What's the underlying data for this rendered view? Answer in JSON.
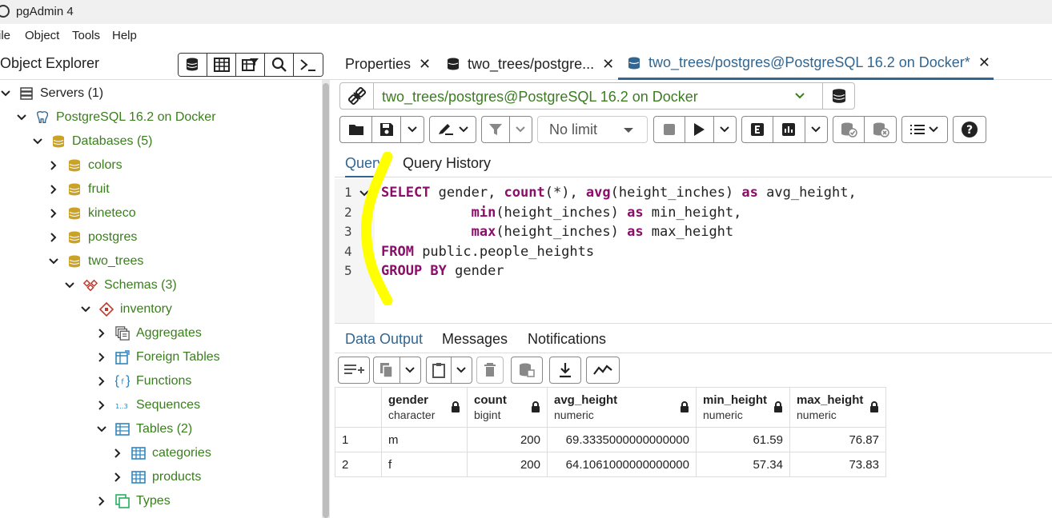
{
  "app": {
    "title": "pgAdmin 4"
  },
  "menu": [
    "ile",
    "Object",
    "Tools",
    "Help"
  ],
  "object_explorer": {
    "title": "Object Explorer",
    "toolbar_icons": [
      "database-query-icon",
      "table-icon",
      "filtered-rows-icon",
      "search-icon",
      "terminal-icon"
    ],
    "tree": [
      {
        "label": "Servers (1)",
        "level": 0,
        "expanded": true,
        "icon": "servers-icon",
        "color": "dark"
      },
      {
        "label": "PostgreSQL 16.2 on Docker",
        "level": 1,
        "expanded": true,
        "icon": "elephant-icon",
        "color": "green"
      },
      {
        "label": "Databases (5)",
        "level": 2,
        "expanded": true,
        "icon": "database-icon",
        "color": "green"
      },
      {
        "label": "colors",
        "level": 3,
        "expanded": false,
        "icon": "database-icon",
        "color": "green"
      },
      {
        "label": "fruit",
        "level": 3,
        "expanded": false,
        "icon": "database-icon",
        "color": "green"
      },
      {
        "label": "kineteco",
        "level": 3,
        "expanded": false,
        "icon": "database-icon",
        "color": "green"
      },
      {
        "label": "postgres",
        "level": 3,
        "expanded": false,
        "icon": "database-icon",
        "color": "green"
      },
      {
        "label": "two_trees",
        "level": 3,
        "expanded": true,
        "icon": "database-icon",
        "color": "green"
      },
      {
        "label": "Schemas (3)",
        "level": 4,
        "expanded": true,
        "icon": "schemas-icon",
        "color": "green"
      },
      {
        "label": "inventory",
        "level": 5,
        "expanded": true,
        "icon": "schema-icon",
        "color": "green"
      },
      {
        "label": "Aggregates",
        "level": 6,
        "expanded": false,
        "icon": "aggregates-icon",
        "color": "green"
      },
      {
        "label": "Foreign Tables",
        "level": 6,
        "expanded": false,
        "icon": "foreign-table-icon",
        "color": "green"
      },
      {
        "label": "Functions",
        "level": 6,
        "expanded": false,
        "icon": "function-icon",
        "color": "green"
      },
      {
        "label": "Sequences",
        "level": 6,
        "expanded": false,
        "icon": "sequence-icon",
        "color": "green"
      },
      {
        "label": "Tables (2)",
        "level": 6,
        "expanded": true,
        "icon": "tables-icon",
        "color": "green"
      },
      {
        "label": "categories",
        "level": 7,
        "expanded": false,
        "icon": "table-icon",
        "color": "green"
      },
      {
        "label": "products",
        "level": 7,
        "expanded": false,
        "icon": "table-icon",
        "color": "green"
      },
      {
        "label": "Types",
        "level": 6,
        "expanded": false,
        "icon": "types-icon",
        "color": "green"
      }
    ]
  },
  "tabs": [
    {
      "label": "Properties",
      "active": false,
      "icon": ""
    },
    {
      "label": "two_trees/postgre...",
      "active": false,
      "icon": "query-tool-icon"
    },
    {
      "label": "two_trees/postgres@PostgreSQL 16.2 on Docker*",
      "active": true,
      "icon": "query-tool-icon"
    }
  ],
  "connection": {
    "value": "two_trees/postgres@PostgreSQL 16.2 on Docker"
  },
  "query_toolbar": {
    "limit": "No limit"
  },
  "editor_tabs": [
    "Query",
    "Query History"
  ],
  "editor": {
    "line_numbers": [
      "1",
      "2",
      "3",
      "4",
      "5"
    ],
    "lines": [
      [
        {
          "t": "SELECT",
          "k": 1
        },
        {
          "t": " gender, "
        },
        {
          "t": "count",
          "k": 1
        },
        {
          "t": "(*), "
        },
        {
          "t": "avg",
          "k": 1
        },
        {
          "t": "(height_inches) "
        },
        {
          "t": "as",
          "k": 1
        },
        {
          "t": " avg_height,"
        }
      ],
      [
        {
          "t": "           "
        },
        {
          "t": "min",
          "k": 1
        },
        {
          "t": "(height_inches) "
        },
        {
          "t": "as",
          "k": 1
        },
        {
          "t": " min_height,"
        }
      ],
      [
        {
          "t": "           "
        },
        {
          "t": "max",
          "k": 1
        },
        {
          "t": "(height_inches) "
        },
        {
          "t": "as",
          "k": 1
        },
        {
          "t": " max_height"
        }
      ],
      [
        {
          "t": "FROM",
          "k": 1
        },
        {
          "t": " public.people_heights"
        }
      ],
      [
        {
          "t": "GROUP BY",
          "k": 1
        },
        {
          "t": " gender"
        }
      ]
    ]
  },
  "output_tabs": [
    "Data Output",
    "Messages",
    "Notifications"
  ],
  "result": {
    "columns": [
      {
        "name": "gender",
        "type": "character"
      },
      {
        "name": "count",
        "type": "bigint"
      },
      {
        "name": "avg_height",
        "type": "numeric"
      },
      {
        "name": "min_height",
        "type": "numeric"
      },
      {
        "name": "max_height",
        "type": "numeric"
      }
    ],
    "rows": [
      {
        "n": "1",
        "cells": [
          "m",
          "200",
          "69.3335000000000000",
          "61.59",
          "76.87"
        ]
      },
      {
        "n": "2",
        "cells": [
          "f",
          "200",
          "64.1061000000000000",
          "57.34",
          "73.83"
        ]
      }
    ]
  },
  "colors": {
    "accent": "#326690",
    "green": "#3a7e1e",
    "keyword": "#8a0e6a",
    "highlight": "#ffff00"
  }
}
